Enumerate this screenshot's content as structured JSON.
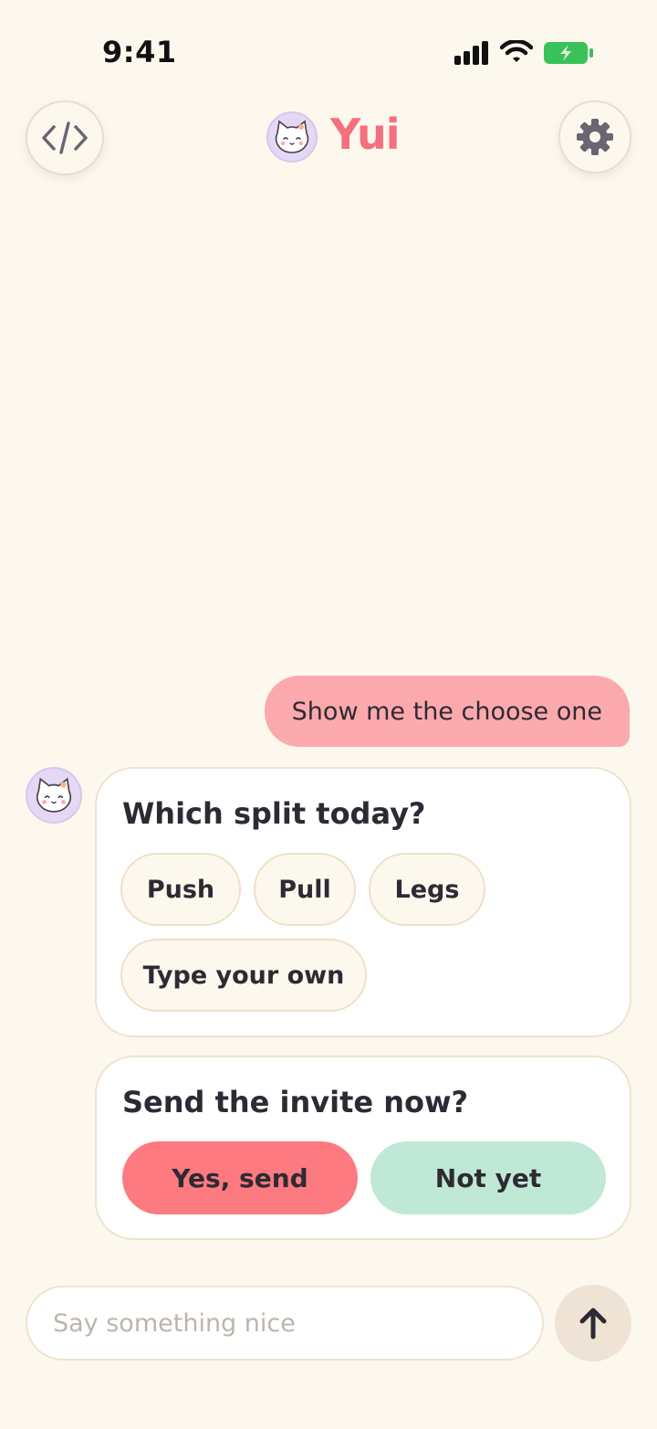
{
  "status_bar": {
    "time": "9:41"
  },
  "header": {
    "brand_name": "Yui",
    "icons": {
      "left": "code-icon",
      "right": "gear-icon",
      "brand": "cat-face-icon"
    }
  },
  "chat": {
    "user_message": "Show me the choose one",
    "choose_card": {
      "title": "Which split today?",
      "options": [
        "Push",
        "Pull",
        "Legs",
        "Type your own"
      ]
    },
    "confirm_card": {
      "title": "Send the invite now?",
      "confirm_label": "Yes, send",
      "cancel_label": "Not yet"
    }
  },
  "composer": {
    "placeholder": "Say something nice",
    "send_icon": "arrow-up-icon"
  },
  "colors": {
    "background": "#fdf8ee",
    "brand": "#f4707e",
    "user_bubble": "#fca9ad",
    "confirm": "#fd7a81",
    "cancel": "#bfe9d6"
  }
}
